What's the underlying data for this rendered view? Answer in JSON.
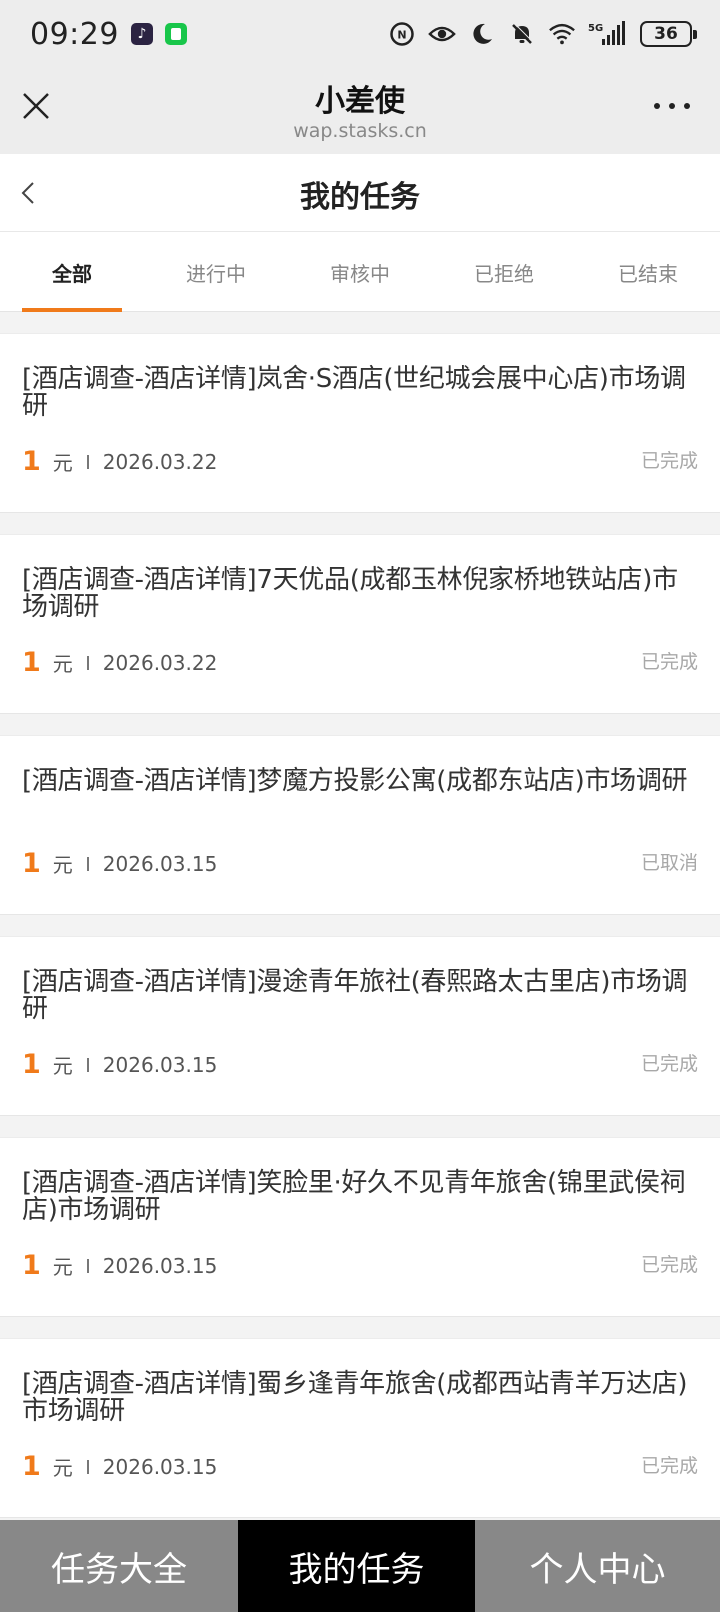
{
  "status_bar": {
    "time": "09:29",
    "battery": "36",
    "network": "5G"
  },
  "browser": {
    "title": "小差使",
    "url": "wap.stasks.cn"
  },
  "page": {
    "title": "我的任务"
  },
  "tabs": [
    {
      "label": "全部",
      "active": true
    },
    {
      "label": "进行中",
      "active": false
    },
    {
      "label": "审核中",
      "active": false
    },
    {
      "label": "已拒绝",
      "active": false
    },
    {
      "label": "已结束",
      "active": false
    }
  ],
  "tasks": [
    {
      "title": "[酒店调查-酒店详情]岚舍·S酒店(世纪城会展中心店)市场调研",
      "amount": "1",
      "unit": "元",
      "date": "2026.03.22",
      "status": "已完成"
    },
    {
      "title": "[酒店调查-酒店详情]7天优品(成都玉林倪家桥地铁站店)市场调研",
      "amount": "1",
      "unit": "元",
      "date": "2026.03.22",
      "status": "已完成"
    },
    {
      "title": "[酒店调查-酒店详情]梦魔方投影公寓(成都东站店)市场调研",
      "amount": "1",
      "unit": "元",
      "date": "2026.03.15",
      "status": "已取消"
    },
    {
      "title": "[酒店调查-酒店详情]漫途青年旅社(春熙路太古里店)市场调研",
      "amount": "1",
      "unit": "元",
      "date": "2026.03.15",
      "status": "已完成"
    },
    {
      "title": "[酒店调查-酒店详情]笑脸里·好久不见青年旅舍(锦里武侯祠店)市场调研",
      "amount": "1",
      "unit": "元",
      "date": "2026.03.15",
      "status": "已完成"
    },
    {
      "title": "[酒店调查-酒店详情]蜀乡逢青年旅舍(成都西站青羊万达店)市场调研",
      "amount": "1",
      "unit": "元",
      "date": "2026.03.15",
      "status": "已完成"
    }
  ],
  "bottom_nav": [
    {
      "label": "任务大全"
    },
    {
      "label": "我的任务"
    },
    {
      "label": "个人中心"
    }
  ],
  "colors": {
    "accent": "#f07a1a",
    "nav_active": "#000000",
    "nav_inactive": "#888888"
  }
}
